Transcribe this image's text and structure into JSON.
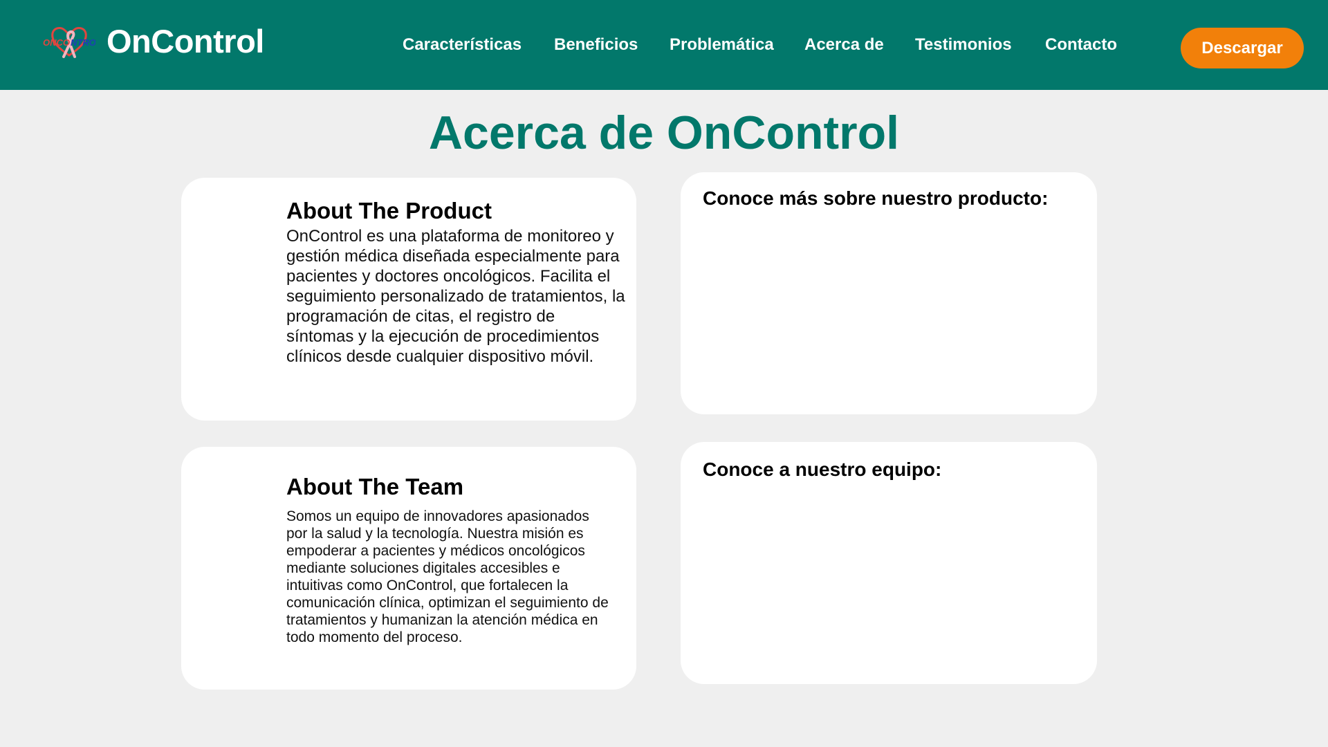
{
  "header": {
    "brand": "OnControl",
    "logo": {
      "icon": "ribbon-heart-logo",
      "text_left": "ONCO",
      "text_right": "NTROL",
      "colors": {
        "red": "#e0463f",
        "blue": "#1f3fb5",
        "ribbon": "#f2b6c0"
      }
    },
    "nav": [
      {
        "label": "Características"
      },
      {
        "label": "Beneficios"
      },
      {
        "label": "Problemática"
      },
      {
        "label": "Acerca de"
      },
      {
        "label": "Testimonios"
      },
      {
        "label": "Contacto"
      }
    ],
    "download_label": "Descargar"
  },
  "main": {
    "title": "Acerca de OnControl",
    "product": {
      "heading": "About The Product",
      "text": "OnControl es una plataforma de monitoreo y gestión médica diseñada especialmente para pacientes y doctores oncológicos. Facilita el seguimiento personalizado de tratamientos, la programación de citas, el registro de síntomas y la ejecución de procedimientos clínicos desde cualquier dispositivo móvil."
    },
    "product_video": {
      "heading": "Conoce más sobre nuestro producto:"
    },
    "team": {
      "heading": "About The Team",
      "text": "Somos un equipo de innovadores apasionados por la salud y la tecnología. Nuestra misión es empoderar a pacientes y médicos oncológicos mediante soluciones digitales accesibles e intuitivas como OnControl, que fortalecen la comunicación clínica, optimizan el seguimiento de tratamientos y humanizan la atención médica en todo momento del proceso."
    },
    "team_video": {
      "heading": "Conoce a nuestro equipo:"
    }
  },
  "colors": {
    "primary": "#02786b",
    "accent": "#f2800a",
    "background": "#efefef",
    "card": "#ffffff"
  }
}
